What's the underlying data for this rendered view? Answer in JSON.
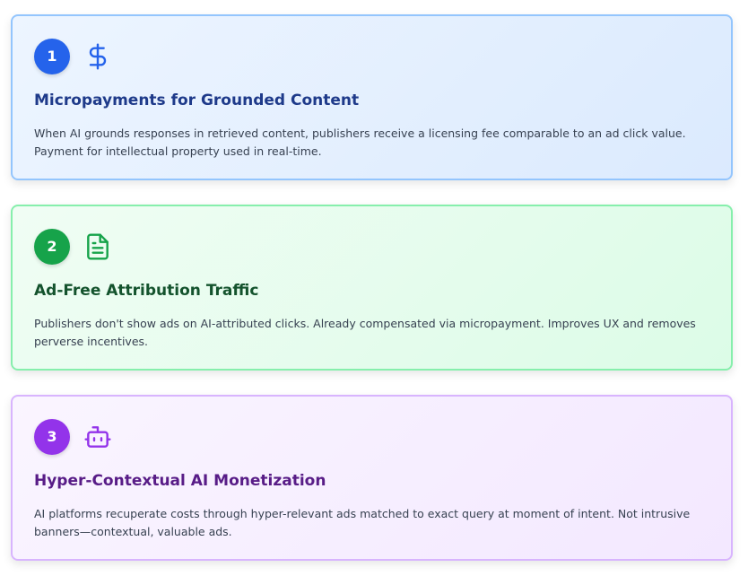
{
  "cards": [
    {
      "number": "1",
      "icon": "dollar-icon",
      "accent": "#2563eb",
      "title": "Micropayments for Grounded Content",
      "description": "When AI grounds responses in retrieved content, publishers receive a licensing fee comparable to an ad click value. Payment for intellectual property used in real-time."
    },
    {
      "number": "2",
      "icon": "document-icon",
      "accent": "#16a34a",
      "title": "Ad-Free Attribution Traffic",
      "description": "Publishers don't show ads on AI-attributed clicks. Already compensated via micropayment. Improves UX and removes perverse incentives."
    },
    {
      "number": "3",
      "icon": "robot-icon",
      "accent": "#9333ea",
      "title": "Hyper-Contextual AI Monetization",
      "description": "AI platforms recuperate costs through hyper-relevant ads matched to exact query at moment of intent. Not intrusive banners—contextual, valuable ads."
    }
  ]
}
